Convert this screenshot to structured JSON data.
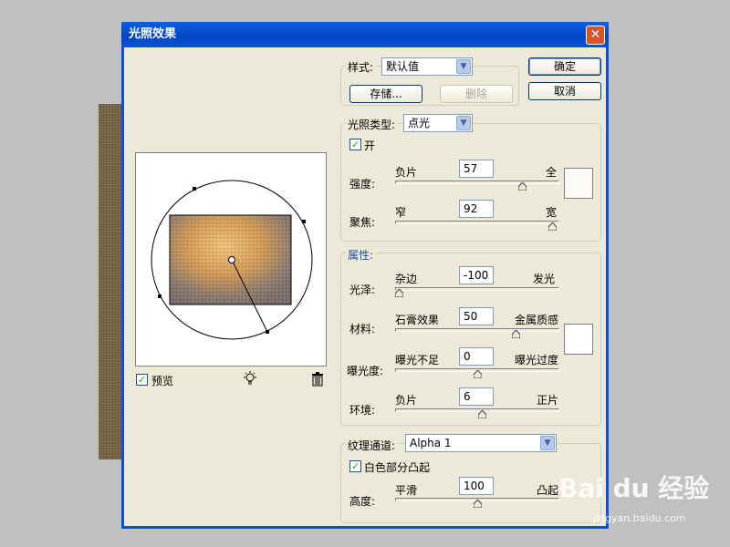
{
  "dialog": {
    "title": "光照效果",
    "close_glyph": "✕"
  },
  "style": {
    "label": "样式:",
    "value": "默认值",
    "save_label": "存储...",
    "delete_label": "删除"
  },
  "actions": {
    "ok": "确定",
    "cancel": "取消"
  },
  "light_type": {
    "label": "光照类型:",
    "value": "点光",
    "on_label": "开",
    "on_checked": true,
    "intensity": {
      "label": "强度:",
      "left": "负片",
      "right": "全",
      "value": "57",
      "slider_fraction": 0.79
    },
    "focus": {
      "label": "聚焦:",
      "left": "窄",
      "right": "宽",
      "value": "92",
      "slider_fraction": 0.98
    },
    "color": "#fcfaf5"
  },
  "properties": {
    "label": "属性:",
    "gloss": {
      "label": "光泽:",
      "left": "杂边",
      "right": "发光",
      "value": "-100",
      "slider_fraction": 0.0
    },
    "material": {
      "label": "材料:",
      "left": "石膏效果",
      "right": "金属质感",
      "value": "50",
      "slider_fraction": 0.75
    },
    "exposure": {
      "label": "曝光度:",
      "left": "曝光不足",
      "right": "曝光过度",
      "value": "0",
      "slider_fraction": 0.5
    },
    "ambience": {
      "label": "环境:",
      "left": "负片",
      "right": "正片",
      "value": "6",
      "slider_fraction": 0.53
    },
    "color": "#ffffff"
  },
  "texture": {
    "label": "纹理通道:",
    "value": "Alpha 1",
    "white_high_label": "白色部分凸起",
    "white_high_checked": true,
    "height": {
      "label": "高度:",
      "left": "平滑",
      "right": "凸起",
      "value": "100",
      "slider_fraction": 0.5
    }
  },
  "preview": {
    "label": "预览",
    "checked": true,
    "bulb_icon": "light-bulb-icon",
    "trash_icon": "trash-icon"
  },
  "watermark": {
    "brand": "Bai du 经验",
    "sub": "jingyan.baidu.com"
  },
  "colors": {
    "title_bar": "#0a52d8",
    "dialog_bg": "#ece9d8",
    "accent_blue": "#1f4ea8"
  }
}
